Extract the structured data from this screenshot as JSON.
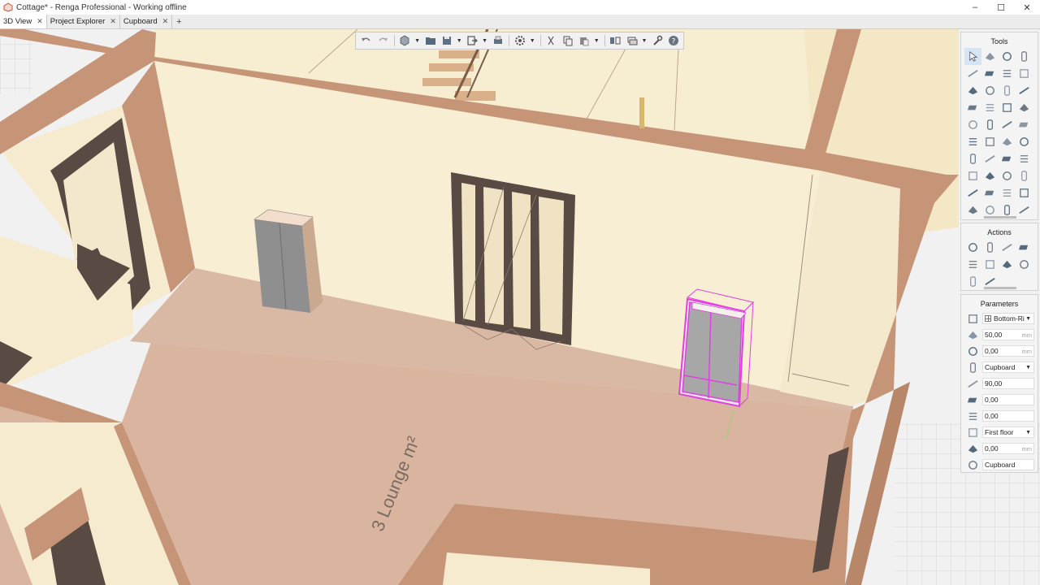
{
  "window": {
    "title": "Cottage* - Renga Professional - Working offline",
    "controls": [
      "–",
      "☐",
      "✕"
    ]
  },
  "tabs": [
    {
      "label": "3D View",
      "active": true
    },
    {
      "label": "Project Explorer",
      "active": false
    },
    {
      "label": "Cupboard",
      "active": false
    }
  ],
  "tab_add": "+",
  "tab_close": "✕",
  "viewport": {
    "room_label": "3  Lounge  m²",
    "colors": {
      "floor": "#d9b5a0",
      "wall_face": "#f7edd1",
      "wall_top": "#c69577",
      "door_frame": "#5a4a44",
      "selection": "#e040e0",
      "cabinet": "#8a8a8a"
    }
  },
  "floating_toolbar": {
    "buttons": [
      "undo-icon",
      "redo-icon",
      "view-cube-icon",
      "folder-icon",
      "save-icon",
      "export-icon",
      "print-icon",
      "settings-gear-icon",
      "cut-icon",
      "copy-icon",
      "paste-icon",
      "align-icon",
      "layers-icon",
      "wrench-icon",
      "help-icon"
    ]
  },
  "tools": {
    "title": "Tools",
    "icons": [
      "select-icon",
      "eraser-icon",
      "rectangle-icon",
      "column-icon",
      "wall-icon",
      "slab-icon",
      "roof-icon",
      "beam-icon",
      "floor-icon",
      "ramp-icon",
      "door-icon",
      "window-icon",
      "railing-icon",
      "line-icon",
      "lamp-icon",
      "pipe-icon",
      "equipment-icon",
      "furniture-icon",
      "plant-icon",
      "stair-icon",
      "cabinet-icon",
      "dimension-icon",
      "section-icon",
      "level-icon",
      "duct-icon",
      "elbow-icon",
      "fan-icon",
      "fitting-icon",
      "sink-icon",
      "sensor-icon",
      "valve-icon",
      "radiator-icon",
      "box-icon",
      "hexagon-icon",
      "pump-icon",
      "connector-icon",
      "grid-icon",
      "filter-icon",
      "brush-icon",
      "shape-icon",
      "text-icon"
    ]
  },
  "actions": {
    "title": "Actions",
    "icons": [
      "move-icon",
      "rotate-icon",
      "array-icon",
      "mirror-icon",
      "align-vertical-icon",
      "scale-icon",
      "replace-icon",
      "extend-icon",
      "split-icon",
      "copy-prop-icon"
    ]
  },
  "parameters": {
    "title": "Parameters",
    "rows": [
      {
        "icon": "alignment-icon",
        "value": "Bottom-Ri",
        "unit": "",
        "dropdown": true,
        "grid": true
      },
      {
        "icon": "offset-x-icon",
        "value": "50,00",
        "unit": "mm",
        "dropdown": false
      },
      {
        "icon": "offset-z-icon",
        "value": "0,00",
        "unit": "mm",
        "dropdown": false
      },
      {
        "icon": "style-icon",
        "value": "Cupboard",
        "unit": "",
        "dropdown": true
      },
      {
        "icon": "angle-icon",
        "value": "90,00",
        "unit": "",
        "dropdown": false
      },
      {
        "icon": "tilt-x-icon",
        "value": "0,00",
        "unit": "",
        "dropdown": false
      },
      {
        "icon": "tilt-y-icon",
        "value": "0,00",
        "unit": "",
        "dropdown": false
      },
      {
        "icon": "level-icon",
        "value": "First floor",
        "unit": "",
        "dropdown": true
      },
      {
        "icon": "elevation-icon",
        "value": "0,00",
        "unit": "mm",
        "dropdown": false
      },
      {
        "icon": "mark-icon",
        "value": "Cupboard",
        "unit": "",
        "dropdown": false
      }
    ]
  }
}
